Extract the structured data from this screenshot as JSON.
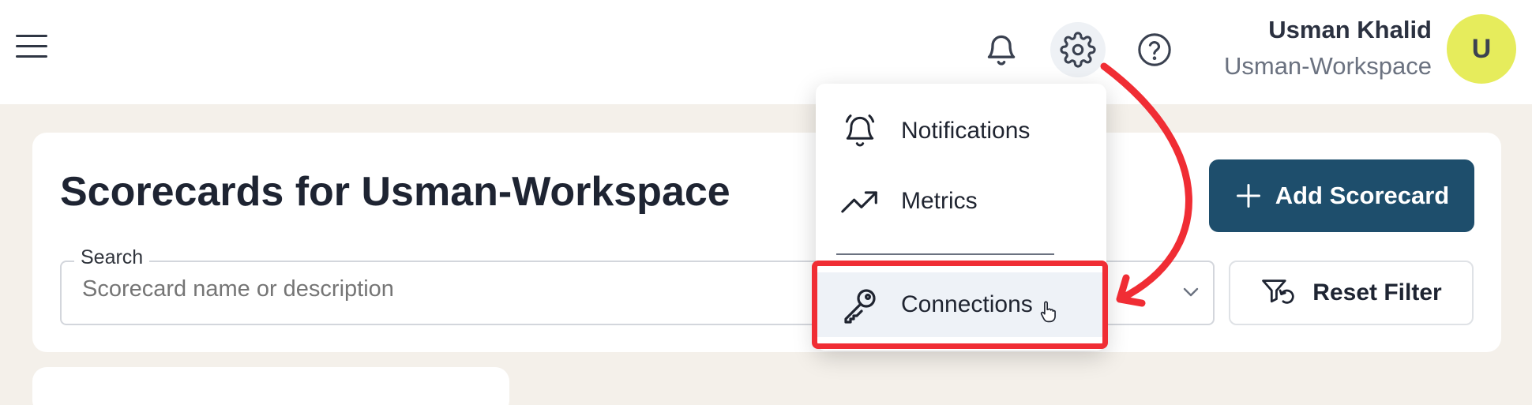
{
  "header": {
    "user_name": "Usman Khalid",
    "workspace": "Usman-Workspace",
    "avatar_letter": "U",
    "icons": [
      "menu-icon",
      "bell-icon",
      "gear-icon",
      "help-icon"
    ]
  },
  "page": {
    "title": "Scorecards for Usman-Workspace",
    "add_button": "Add Scorecard",
    "reset_button": "Reset Filter",
    "search": {
      "label": "Search",
      "placeholder": "Scorecard name or description"
    }
  },
  "settings_menu": {
    "items": [
      {
        "label": "Notifications",
        "icon": "bell-outline-icon"
      },
      {
        "label": "Metrics",
        "icon": "trending-up-icon"
      },
      {
        "label": "Connections",
        "icon": "key-icon"
      }
    ]
  },
  "colors": {
    "primary": "#1e4e6c",
    "avatar": "#e6ec5c",
    "annotation": "#f02d34",
    "background": "#f4f0ea"
  }
}
